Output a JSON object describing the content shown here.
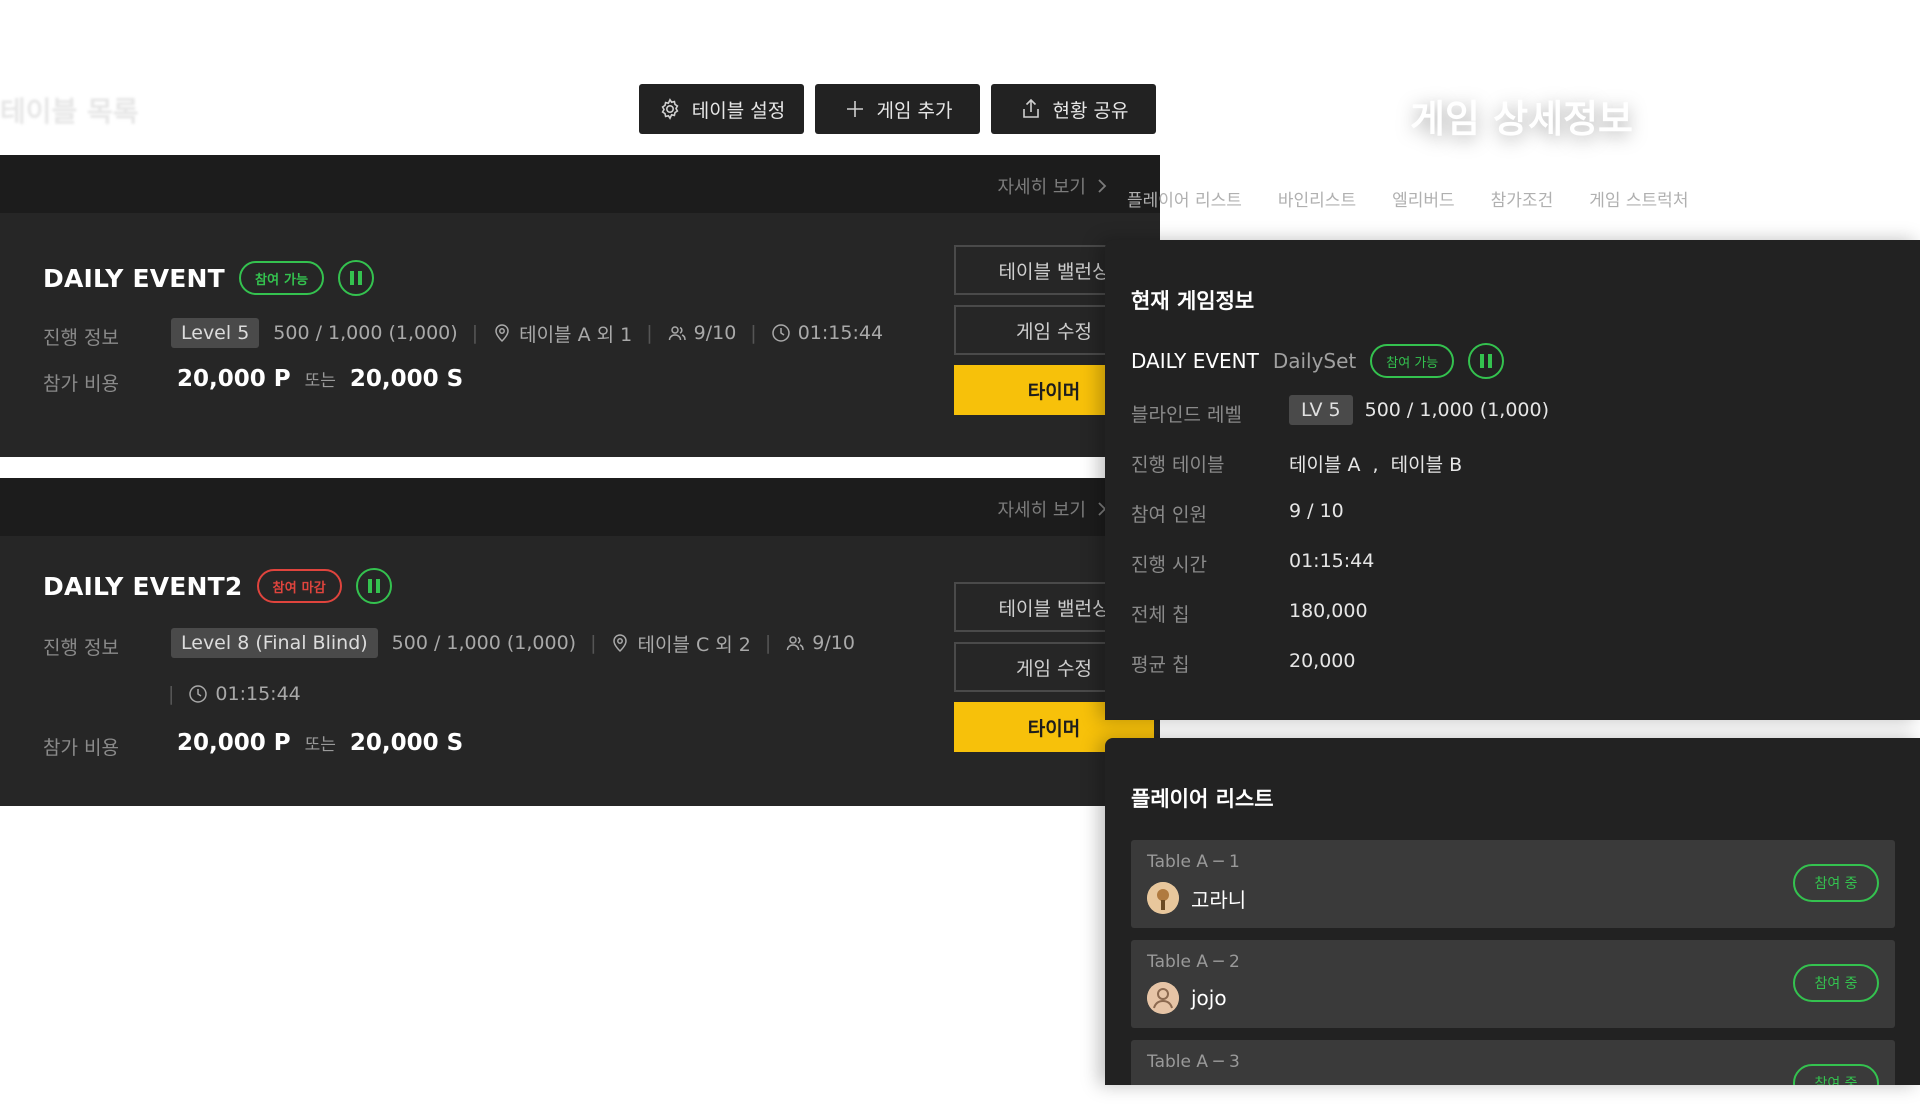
{
  "header": {
    "faint_title": "테이블 목록",
    "detail_title": "게임 상세정보"
  },
  "toolbar": {
    "table_settings": "테이블 설정",
    "add_game": "게임 추가",
    "share_status": "현황 공유"
  },
  "events": [
    {
      "detail_link": "자세히 보기",
      "title": "DAILY EVENT",
      "status": "참여 가능",
      "progress_label": "진행 정보",
      "level": "Level 5",
      "blinds": "500 / 1,000 (1,000)",
      "tables": "테이블 A 외 1",
      "players": "9/10",
      "time": "01:15:44",
      "fee_label": "참가 비용",
      "fee_p": "20,000 P",
      "fee_or": "또는",
      "fee_s": "20,000 S",
      "btn_balancing": "테이블 밸런싱",
      "btn_edit": "게임 수정",
      "btn_timer": "타이머"
    },
    {
      "detail_link": "자세히 보기",
      "title": "DAILY EVENT2",
      "status": "참여 마감",
      "progress_label": "진행 정보",
      "level": "Level 8 (Final Blind)",
      "blinds": "500 / 1,000 (1,000)",
      "tables": "테이블 C 외 2",
      "players": "9/10",
      "time": "01:15:44",
      "fee_label": "참가 비용",
      "fee_p": "20,000 P",
      "fee_or": "또는",
      "fee_s": "20,000 S",
      "btn_balancing": "테이블 밸런싱",
      "btn_edit": "게임 수정",
      "btn_timer": "타이머"
    }
  ],
  "tabs": [
    "플레이어 리스트",
    "바인리스트",
    "엘리버드",
    "참가조건",
    "게임 스트럭처"
  ],
  "game_info": {
    "title": "현재 게임정보",
    "name": "DAILY EVENT",
    "sub": "DailySet",
    "status": "참여 가능",
    "rows": [
      {
        "label": "블라인드 레벨",
        "value": "500 / 1,000 (1,000)",
        "badge": "LV 5"
      },
      {
        "label": "진행 테이블",
        "value": "테이블 A  ,  테이블 B"
      },
      {
        "label": "참여 인원",
        "value": "9 / 10"
      },
      {
        "label": "진행 시간",
        "value": "01:15:44"
      },
      {
        "label": "전체 칩",
        "value": "180,000"
      },
      {
        "label": "평균 칩",
        "value": "20,000"
      }
    ]
  },
  "player_list": {
    "title": "플레이어 리스트",
    "players": [
      {
        "table": "Table A  ─  1",
        "name": "고라니",
        "status": "참여 중"
      },
      {
        "table": "Table A  ─  2",
        "name": "jojo",
        "status": "참여 중"
      },
      {
        "table": "Table A  ─  3",
        "name": "",
        "status": "참여 중"
      }
    ]
  },
  "colors": {
    "accent_yellow": "#f7c10a",
    "status_green": "#34c24f",
    "status_red": "#e0443d",
    "panel_bg": "#222222",
    "card_bg": "#262626"
  }
}
